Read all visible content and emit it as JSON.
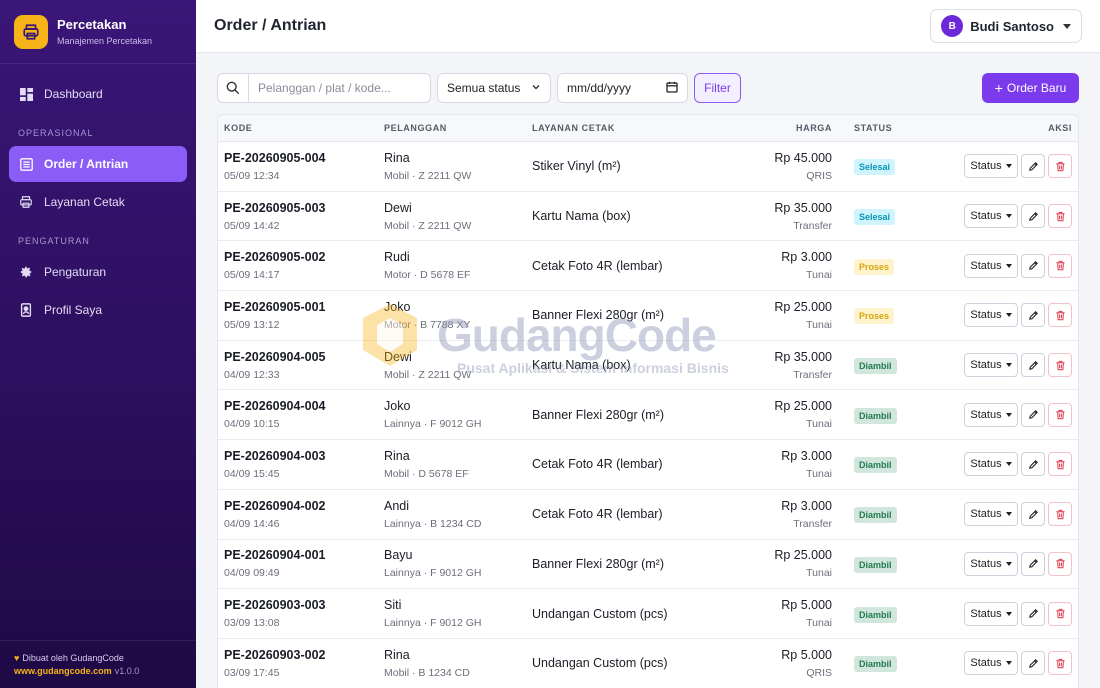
{
  "brand": {
    "name": "Percetakan",
    "subtitle": "Manajemen Percetakan"
  },
  "nav": {
    "dashboard": "Dashboard",
    "section_operasional": "OPERASIONAL",
    "order_antrian": "Order / Antrian",
    "layanan_cetak": "Layanan Cetak",
    "section_pengaturan": "PENGATURAN",
    "pengaturan": "Pengaturan",
    "profil_saya": "Profil Saya"
  },
  "footer": {
    "made_by": "Dibuat oleh GudangCode",
    "link": "www.gudangcode.com",
    "version": "v1.0.0"
  },
  "header": {
    "title": "Order / Antrian",
    "user_initial": "B",
    "user_name": "Budi Santoso"
  },
  "toolbar": {
    "search_placeholder": "Pelanggan / plat / kode...",
    "status_select": "Semua status",
    "date_placeholder": "mm/dd/yyyy",
    "filter_label": "Filter",
    "new_order_label": "Order Baru"
  },
  "table": {
    "headers": {
      "kode": "KODE",
      "pelanggan": "PELANGGAN",
      "layanan": "LAYANAN CETAK",
      "harga": "HARGA",
      "status": "STATUS",
      "aksi": "AKSI"
    },
    "status_button": "Status",
    "rows": [
      {
        "kode": "PE-20260905-004",
        "time": "05/09 12:34",
        "name": "Rina",
        "vehicle": "Mobil · Z 2211 QW",
        "service": "Stiker Vinyl (m²)",
        "price": "Rp 45.000",
        "method": "QRIS",
        "status": "Selesai",
        "status_kind": "selesai"
      },
      {
        "kode": "PE-20260905-003",
        "time": "05/09 14:42",
        "name": "Dewi",
        "vehicle": "Mobil · Z 2211 QW",
        "service": "Kartu Nama (box)",
        "price": "Rp 35.000",
        "method": "Transfer",
        "status": "Selesai",
        "status_kind": "selesai"
      },
      {
        "kode": "PE-20260905-002",
        "time": "05/09 14:17",
        "name": "Rudi",
        "vehicle": "Motor · D 5678 EF",
        "service": "Cetak Foto 4R (lembar)",
        "price": "Rp 3.000",
        "method": "Tunai",
        "status": "Proses",
        "status_kind": "proses"
      },
      {
        "kode": "PE-20260905-001",
        "time": "05/09 13:12",
        "name": "Joko",
        "vehicle": "Motor · B 7788 XY",
        "service": "Banner Flexi 280gr (m²)",
        "price": "Rp 25.000",
        "method": "Tunai",
        "status": "Proses",
        "status_kind": "proses"
      },
      {
        "kode": "PE-20260904-005",
        "time": "04/09 12:33",
        "name": "Dewi",
        "vehicle": "Mobil · Z 2211 QW",
        "service": "Kartu Nama (box)",
        "price": "Rp 35.000",
        "method": "Transfer",
        "status": "Diambil",
        "status_kind": "diambil"
      },
      {
        "kode": "PE-20260904-004",
        "time": "04/09 10:15",
        "name": "Joko",
        "vehicle": "Lainnya · F 9012 GH",
        "service": "Banner Flexi 280gr (m²)",
        "price": "Rp 25.000",
        "method": "Tunai",
        "status": "Diambil",
        "status_kind": "diambil"
      },
      {
        "kode": "PE-20260904-003",
        "time": "04/09 15:45",
        "name": "Rina",
        "vehicle": "Mobil · D 5678 EF",
        "service": "Cetak Foto 4R (lembar)",
        "price": "Rp 3.000",
        "method": "Tunai",
        "status": "Diambil",
        "status_kind": "diambil"
      },
      {
        "kode": "PE-20260904-002",
        "time": "04/09 14:46",
        "name": "Andi",
        "vehicle": "Lainnya · B 1234 CD",
        "service": "Cetak Foto 4R (lembar)",
        "price": "Rp 3.000",
        "method": "Transfer",
        "status": "Diambil",
        "status_kind": "diambil"
      },
      {
        "kode": "PE-20260904-001",
        "time": "04/09 09:49",
        "name": "Bayu",
        "vehicle": "Lainnya · F 9012 GH",
        "service": "Banner Flexi 280gr (m²)",
        "price": "Rp 25.000",
        "method": "Tunai",
        "status": "Diambil",
        "status_kind": "diambil"
      },
      {
        "kode": "PE-20260903-003",
        "time": "03/09 13:08",
        "name": "Siti",
        "vehicle": "Lainnya · F 9012 GH",
        "service": "Undangan Custom (pcs)",
        "price": "Rp 5.000",
        "method": "Tunai",
        "status": "Diambil",
        "status_kind": "diambil"
      },
      {
        "kode": "PE-20260903-002",
        "time": "03/09 17:45",
        "name": "Rina",
        "vehicle": "Mobil · B 1234 CD",
        "service": "Undangan Custom (pcs)",
        "price": "Rp 5.000",
        "method": "QRIS",
        "status": "Diambil",
        "status_kind": "diambil"
      }
    ]
  },
  "watermark": {
    "title": "GudangCode",
    "subtitle": "Pusat Aplikasi & Sistem Informasi Bisnis"
  },
  "colors": {
    "accent": "#7c3aed",
    "sidebar": "#2c0f5e",
    "brand_logo": "#f6b418"
  }
}
